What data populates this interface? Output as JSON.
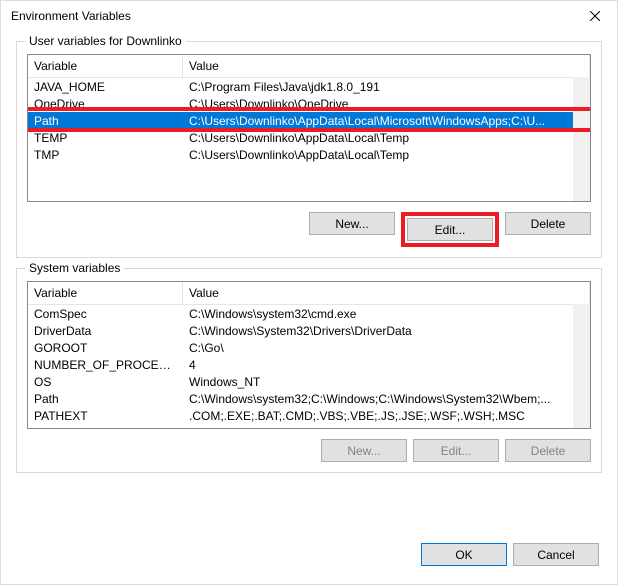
{
  "titlebar": {
    "title": "Environment Variables"
  },
  "user_section": {
    "label": "User variables for Downlinko",
    "columns": {
      "variable": "Variable",
      "value": "Value"
    },
    "rows": [
      {
        "name": "JAVA_HOME",
        "value": "C:\\Program Files\\Java\\jdk1.8.0_191",
        "selected": false
      },
      {
        "name": "OneDrive",
        "value": "C:\\Users\\Downlinko\\OneDrive",
        "selected": false
      },
      {
        "name": "Path",
        "value": "C:\\Users\\Downlinko\\AppData\\Local\\Microsoft\\WindowsApps;C:\\U...",
        "selected": true
      },
      {
        "name": "TEMP",
        "value": "C:\\Users\\Downlinko\\AppData\\Local\\Temp",
        "selected": false
      },
      {
        "name": "TMP",
        "value": "C:\\Users\\Downlinko\\AppData\\Local\\Temp",
        "selected": false
      }
    ],
    "buttons": {
      "new": "New...",
      "edit": "Edit...",
      "delete": "Delete"
    }
  },
  "system_section": {
    "label": "System variables",
    "columns": {
      "variable": "Variable",
      "value": "Value"
    },
    "rows": [
      {
        "name": "ComSpec",
        "value": "C:\\Windows\\system32\\cmd.exe"
      },
      {
        "name": "DriverData",
        "value": "C:\\Windows\\System32\\Drivers\\DriverData"
      },
      {
        "name": "GOROOT",
        "value": "C:\\Go\\"
      },
      {
        "name": "NUMBER_OF_PROCESSORS",
        "value": "4"
      },
      {
        "name": "OS",
        "value": "Windows_NT"
      },
      {
        "name": "Path",
        "value": "C:\\Windows\\system32;C:\\Windows;C:\\Windows\\System32\\Wbem;..."
      },
      {
        "name": "PATHEXT",
        "value": ".COM;.EXE;.BAT;.CMD;.VBS;.VBE;.JS;.JSE;.WSF;.WSH;.MSC"
      }
    ],
    "buttons": {
      "new": "New...",
      "edit": "Edit...",
      "delete": "Delete"
    }
  },
  "footer": {
    "ok": "OK",
    "cancel": "Cancel"
  }
}
